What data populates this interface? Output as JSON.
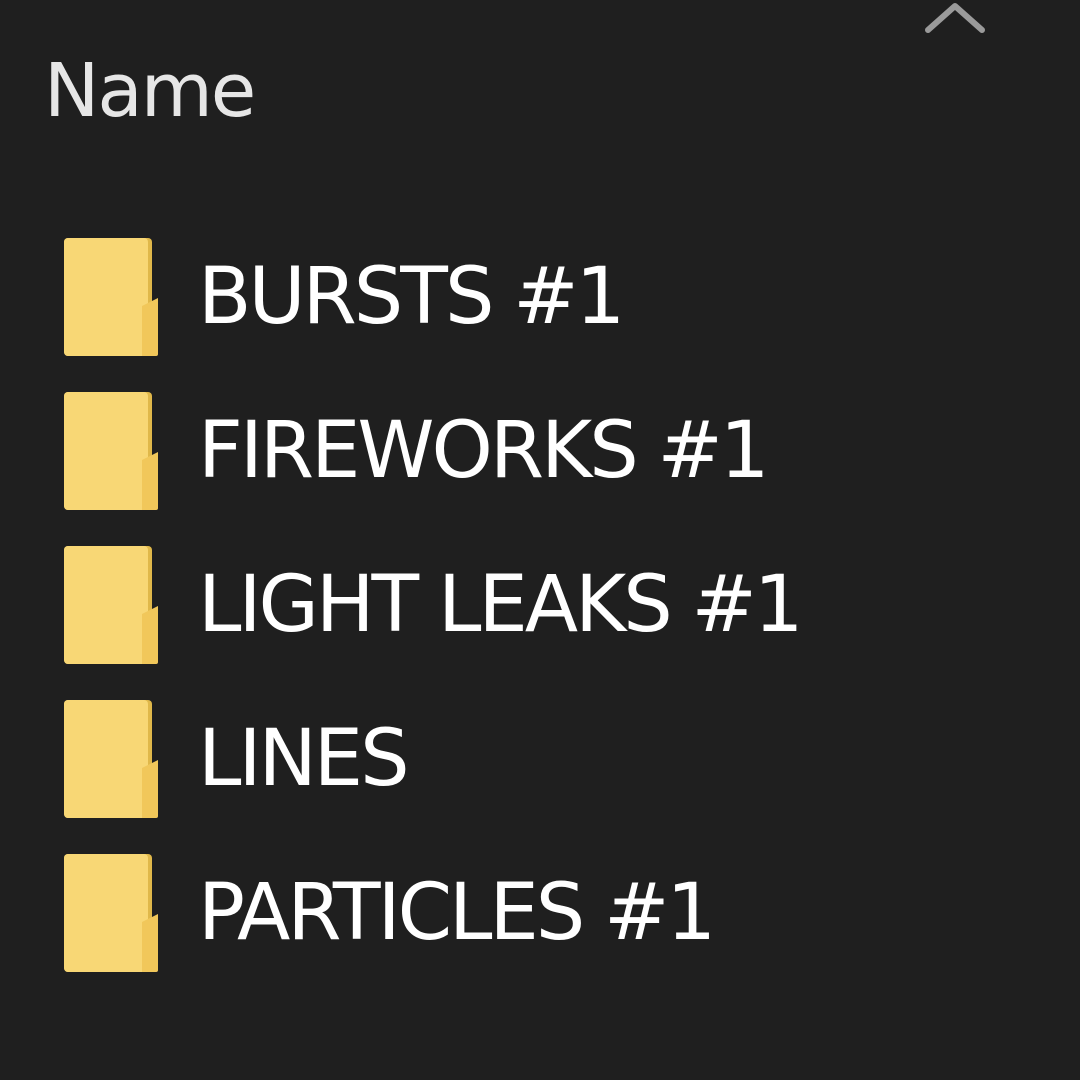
{
  "header": {
    "column_name": "Name",
    "sort_icon": "chevron-up-icon"
  },
  "folders": [
    {
      "label": "BURSTS #1",
      "icon": "folder-icon"
    },
    {
      "label": "FIREWORKS #1",
      "icon": "folder-icon"
    },
    {
      "label": "LIGHT LEAKS #1",
      "icon": "folder-icon"
    },
    {
      "label": "LINES",
      "icon": "folder-icon"
    },
    {
      "label": "PARTICLES #1",
      "icon": "folder-icon"
    }
  ],
  "colors": {
    "background": "#1f1f1f",
    "folder_front": "#f8d775",
    "folder_back": "#e0b84a",
    "text": "#ffffff"
  }
}
